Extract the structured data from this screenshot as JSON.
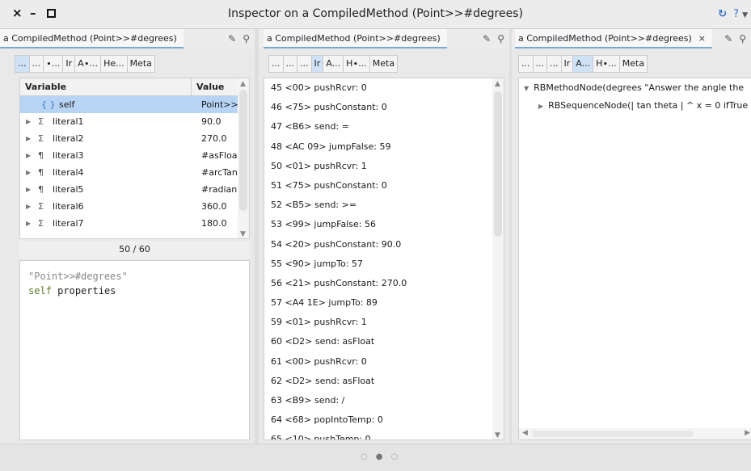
{
  "window": {
    "title": "Inspector on a CompiledMethod (Point>>#degrees)",
    "close": "×",
    "minimize": "–",
    "help": "?"
  },
  "panes": [
    {
      "tab_title": "a CompiledMethod (Point>>#degrees)",
      "subtabs": [
        "...",
        "...",
        "∙...",
        "Ir",
        "A∙...",
        "He...",
        "Meta"
      ],
      "table": {
        "headers": [
          "Variable",
          "Value"
        ],
        "rows": [
          {
            "kind": "{ }",
            "name": "self",
            "value": "Point>>..."
          },
          {
            "kind": "Σ",
            "name": "literal1",
            "value": "90.0"
          },
          {
            "kind": "Σ",
            "name": "literal2",
            "value": "270.0"
          },
          {
            "kind": "¶",
            "name": "literal3",
            "value": "#asFloat"
          },
          {
            "kind": "¶",
            "name": "literal4",
            "value": "#arcTan"
          },
          {
            "kind": "¶",
            "name": "literal5",
            "value": "#radian..."
          },
          {
            "kind": "Σ",
            "name": "literal6",
            "value": "360.0"
          },
          {
            "kind": "Σ",
            "name": "literal7",
            "value": "180.0"
          }
        ]
      },
      "pager": "50 / 60",
      "code": {
        "comment": "\"Point>>#degrees\"",
        "receiver": "self",
        "message": "properties"
      }
    },
    {
      "tab_title": "a CompiledMethod (Point>>#degrees)",
      "subtabs": [
        "...",
        "...",
        "...",
        "Ir",
        "A...",
        "H∙...",
        "Meta"
      ],
      "bytecodes": [
        "45 <00> pushRcvr: 0",
        "46 <75> pushConstant: 0",
        "47 <B6> send: =",
        "48 <AC 09> jumpFalse: 59",
        "50 <01> pushRcvr: 1",
        "51 <75> pushConstant: 0",
        "52 <B5> send: >=",
        "53 <99> jumpFalse: 56",
        "54 <20> pushConstant: 90.0",
        "55 <90> jumpTo: 57",
        "56 <21> pushConstant: 270.0",
        "57 <A4 1E> jumpTo: 89",
        "59 <01> pushRcvr: 1",
        "60 <D2> send: asFloat",
        "61 <00> pushRcvr: 0",
        "62 <D2> send: asFloat",
        "63 <B9> send: /",
        "64 <68> popIntoTemp: 0",
        "65 <10> pushTemp: 0"
      ]
    },
    {
      "tab_title": "a CompiledMethod (Point>>#degrees)",
      "tab_close": "×",
      "subtabs": [
        "...",
        "...",
        "...",
        "Ir",
        "A...",
        "H∙...",
        "Meta"
      ],
      "tree": [
        "RBMethodNode(degrees   \"Answer the angle the",
        "RBSequenceNode(| tan theta | ^ x = 0    ifTrue"
      ]
    }
  ],
  "colors": {
    "selection": "#b8d4f5",
    "tab_underline": "#7aa6d8",
    "accent": "#3b73c9"
  },
  "icons": {
    "tab_edit": "pencil-icon",
    "tab_inspect": "magnifier-icon",
    "refresh": "refresh-icon",
    "menu": "caret-down-icon"
  }
}
